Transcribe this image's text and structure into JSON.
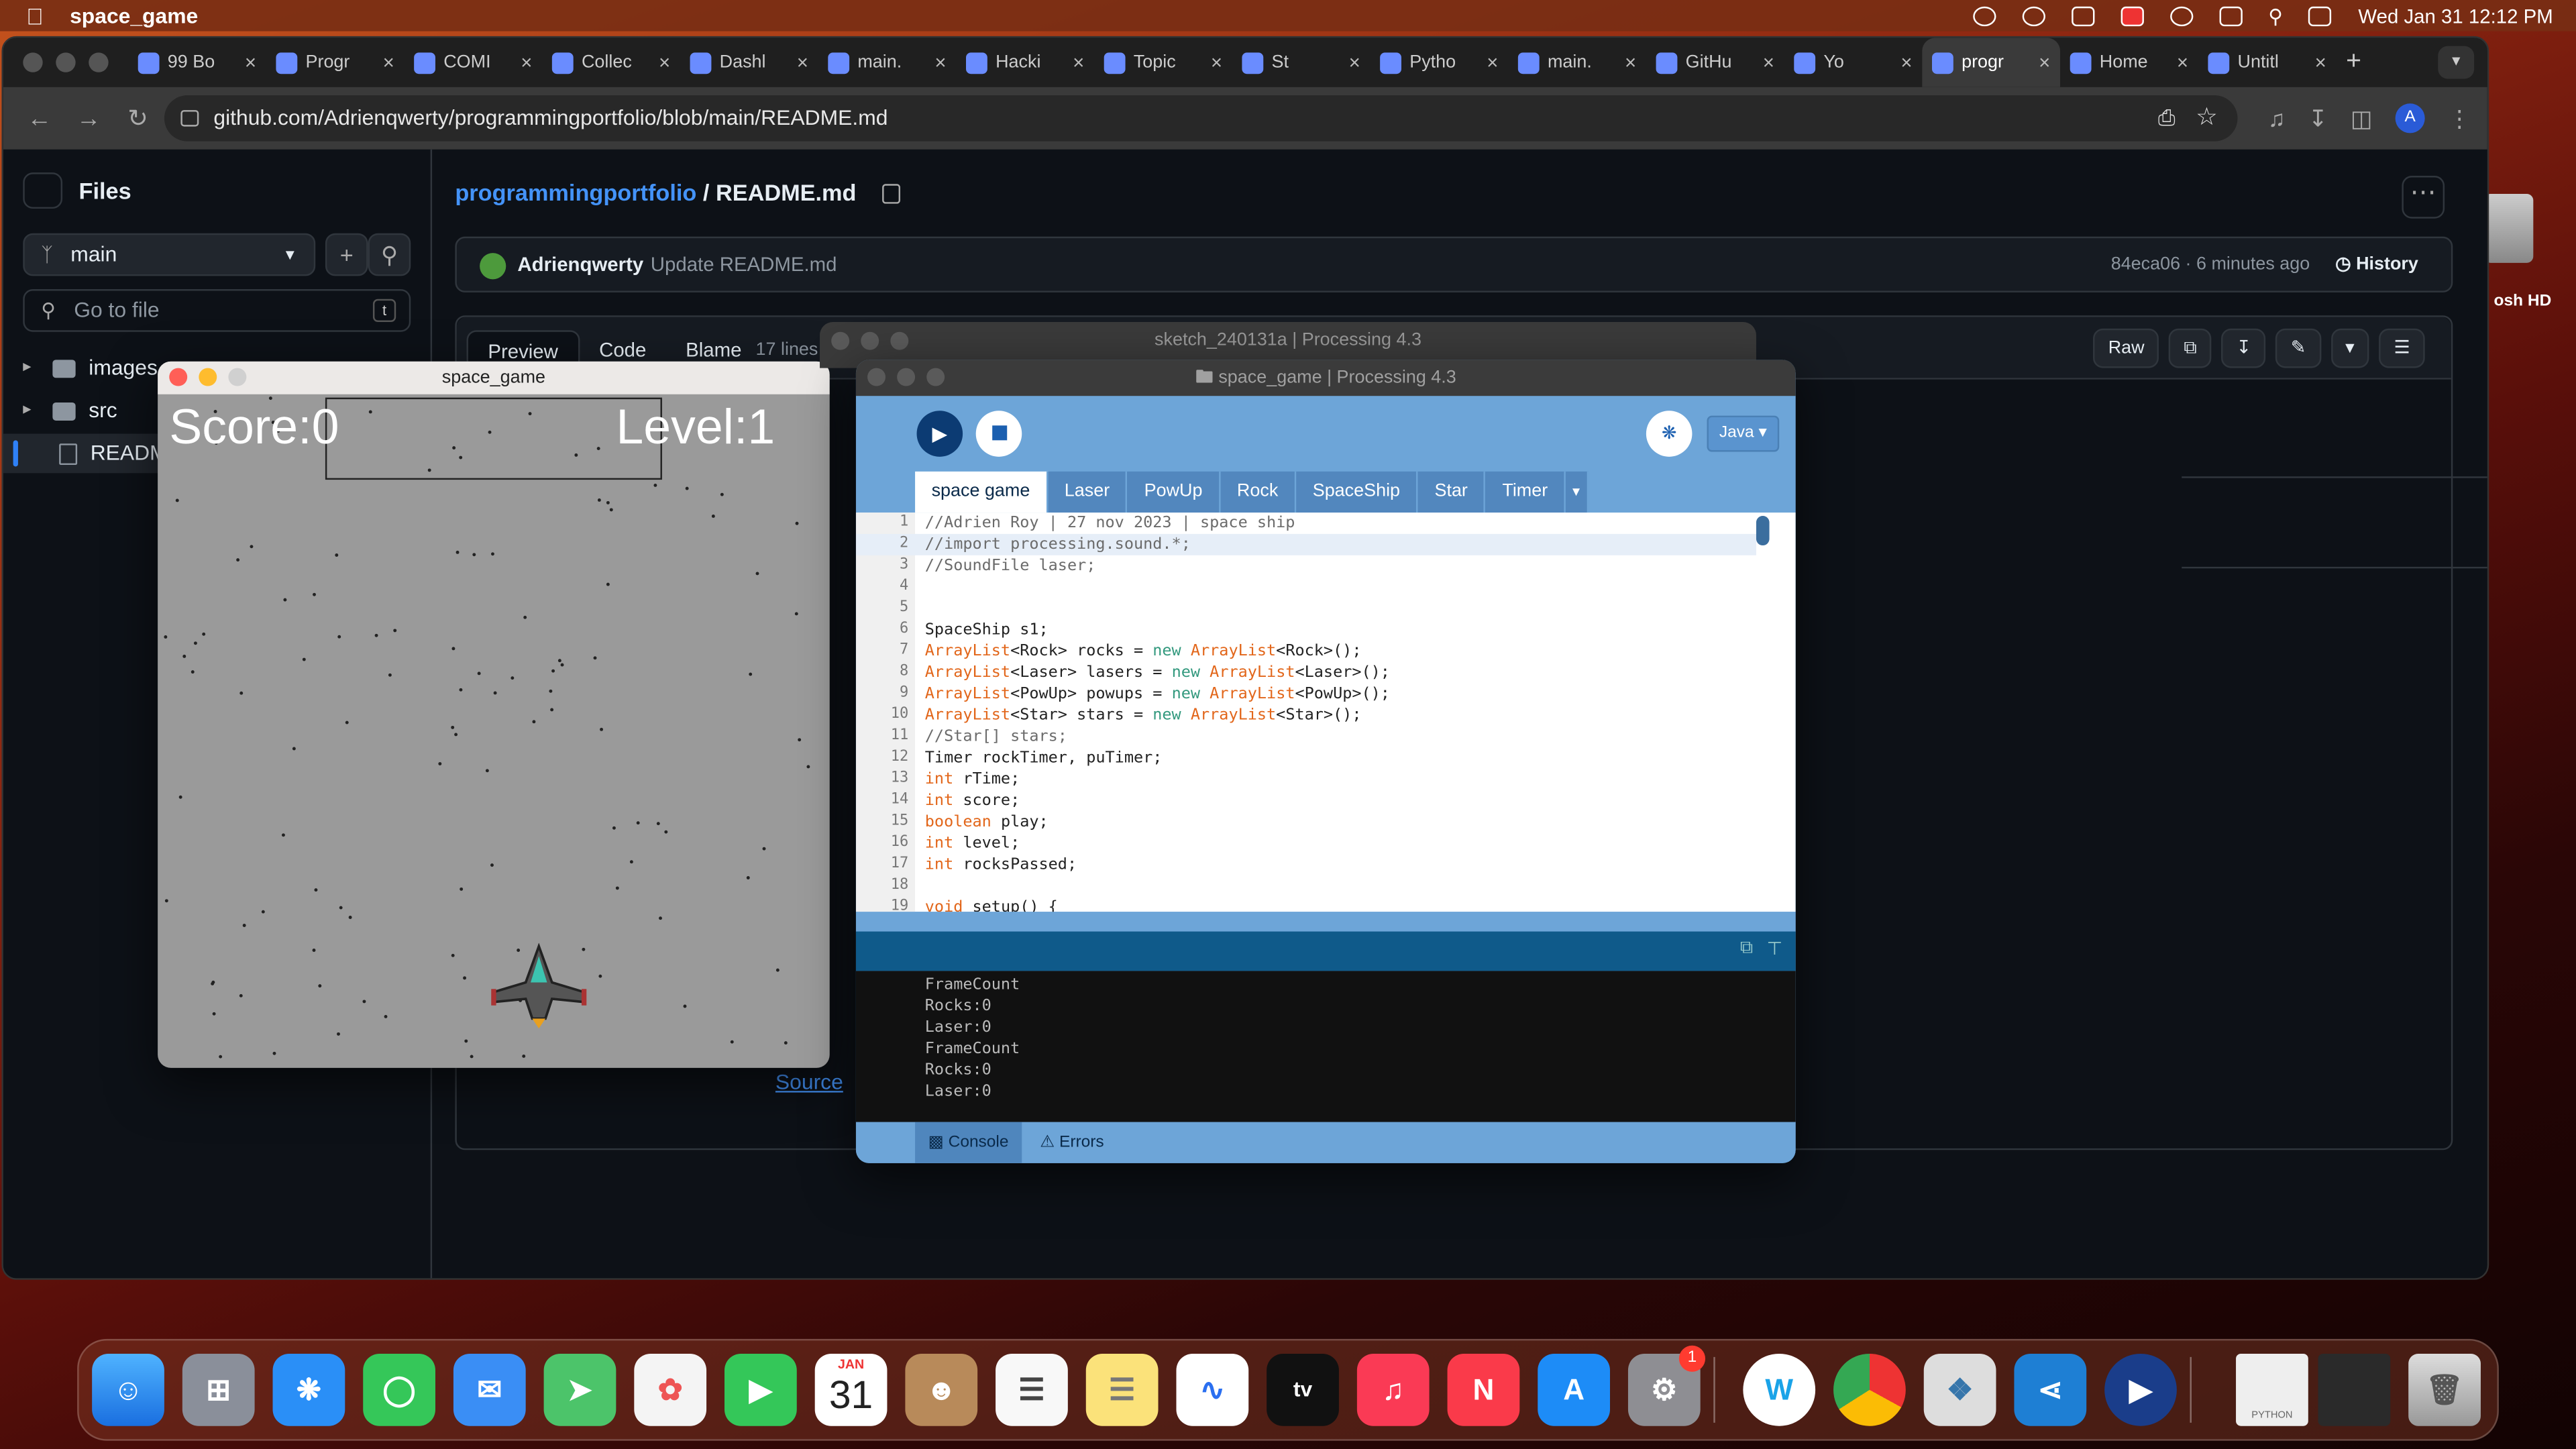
{
  "menubar": {
    "app_name": "space_game",
    "datetime": "Wed Jan 31   12:12 PM"
  },
  "desktop": {
    "disk_label": "osh HD"
  },
  "browser": {
    "tabs": [
      {
        "label": "99 Bo"
      },
      {
        "label": "Progr"
      },
      {
        "label": "COMI"
      },
      {
        "label": "Collec"
      },
      {
        "label": "Dashl"
      },
      {
        "label": "main."
      },
      {
        "label": "Hacki"
      },
      {
        "label": "Topic"
      },
      {
        "label": "St"
      },
      {
        "label": "Pytho"
      },
      {
        "label": "main."
      },
      {
        "label": "GitHu"
      },
      {
        "label": "Yo"
      },
      {
        "label": "progr"
      },
      {
        "label": "Home"
      },
      {
        "label": "Untitl"
      }
    ],
    "active_tab_index": 13,
    "new_tab": "+",
    "url": "github.com/Adrienqwerty/programmingportfolio/blob/main/README.md"
  },
  "github": {
    "files_title": "Files",
    "branch": "main",
    "goto_placeholder": "Go to file",
    "goto_shortcut": "t",
    "tree": [
      {
        "name": "images",
        "type": "folder"
      },
      {
        "name": "src",
        "type": "folder"
      },
      {
        "name": "README.md",
        "type": "file",
        "selected": true
      }
    ],
    "repo_link": "programmingportfolio",
    "separator": "/",
    "file_name": "README.md",
    "commit_author": "Adrienqwerty",
    "commit_message": "Update README.md",
    "commit_meta": "84eca06 · 6 minutes ago",
    "history_label": "History",
    "view_tabs": [
      "Preview",
      "Code",
      "Blame"
    ],
    "line_count": "17 lines",
    "raw_label": "Raw",
    "source_link": "Source"
  },
  "game_window": {
    "title": "space_game",
    "score": "Score:0",
    "level": "Level:1"
  },
  "processing_back": {
    "title": "sketch_240131a | Processing 4.3"
  },
  "processing": {
    "title": "space_game | Processing 4.3",
    "mode": "Java ▾",
    "tabs": [
      "space game",
      "Laser",
      "PowUp",
      "Rock",
      "SpaceShip",
      "Star",
      "Timer",
      "▾"
    ],
    "code": [
      {
        "n": "1",
        "t": "//Adrien Roy | 27 nov 2023 | space ship"
      },
      {
        "n": "2",
        "t": "//import processing.sound.*;"
      },
      {
        "n": "3",
        "t": "//SoundFile laser;"
      },
      {
        "n": "4",
        "t": ""
      },
      {
        "n": "5",
        "t": ""
      },
      {
        "n": "6",
        "t": "SpaceShip s1;"
      },
      {
        "n": "7",
        "t": "ArrayList<Rock> rocks = new ArrayList<Rock>();"
      },
      {
        "n": "8",
        "t": "ArrayList<Laser> lasers = new ArrayList<Laser>();"
      },
      {
        "n": "9",
        "t": "ArrayList<PowUp> powups = new ArrayList<PowUp>();"
      },
      {
        "n": "10",
        "t": "ArrayList<Star> stars = new ArrayList<Star>();"
      },
      {
        "n": "11",
        "t": "//Star[] stars;"
      },
      {
        "n": "12",
        "t": "Timer rockTimer, puTimer;"
      },
      {
        "n": "13",
        "t": "int rTime;"
      },
      {
        "n": "14",
        "t": "int score;"
      },
      {
        "n": "15",
        "t": "boolean play;"
      },
      {
        "n": "16",
        "t": "int level;"
      },
      {
        "n": "17",
        "t": "int rocksPassed;"
      },
      {
        "n": "18",
        "t": ""
      },
      {
        "n": "19",
        "t": "void setup() {"
      }
    ],
    "console": [
      "FrameCount",
      "Rocks:0",
      "Laser:0",
      "FrameCount",
      "Rocks:0",
      "Laser:0"
    ],
    "footer_tabs": [
      "Console",
      "Errors"
    ]
  },
  "dock": {
    "calendar_month": "JAN",
    "calendar_day": "31",
    "settings_badge": "1",
    "python_doc_label": "PYTHON"
  }
}
